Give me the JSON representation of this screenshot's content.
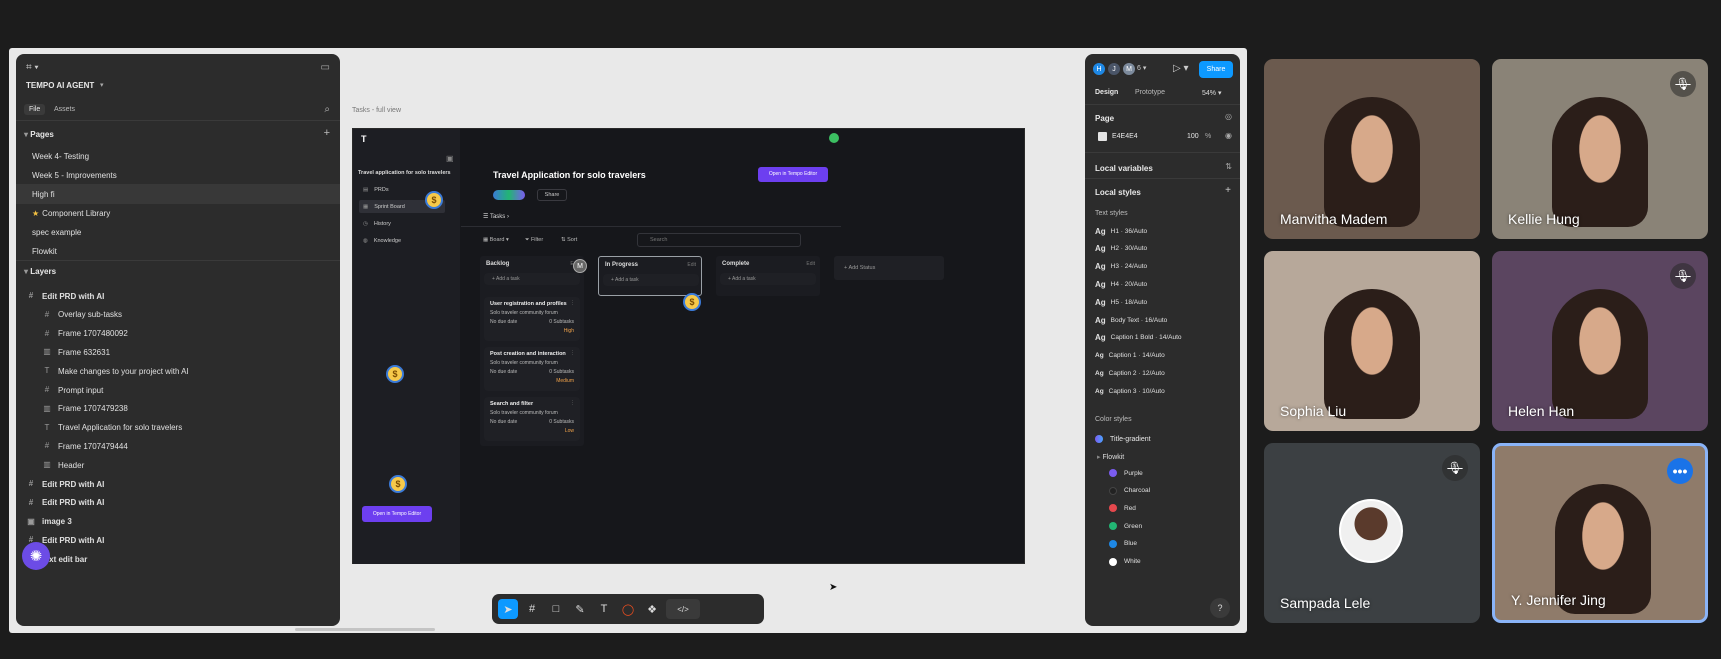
{
  "left_panel": {
    "project_name": "TEMPO AI AGENT",
    "tabs": [
      "File",
      "Assets"
    ],
    "pages_label": "Pages",
    "pages": [
      "Week 4- Testing",
      "Week 5 - Improvements",
      "High fi",
      "Component Library",
      "spec example",
      "Flowkit"
    ],
    "layers_label": "Layers",
    "layers": [
      {
        "label": "Edit PRD with AI",
        "indent": 0,
        "icon": "#"
      },
      {
        "label": "Overlay sub-tasks",
        "indent": 1,
        "icon": "#"
      },
      {
        "label": "Frame 1707480092",
        "indent": 1,
        "icon": "#"
      },
      {
        "label": "Frame 632631",
        "indent": 1,
        "icon": "▥"
      },
      {
        "label": "Make changes to your project with AI",
        "indent": 1,
        "icon": "T"
      },
      {
        "label": "Prompt input",
        "indent": 1,
        "icon": "#"
      },
      {
        "label": "Frame 1707479238",
        "indent": 1,
        "icon": "▥"
      },
      {
        "label": "Travel Application for solo travelers",
        "indent": 1,
        "icon": "T"
      },
      {
        "label": "Frame 1707479444",
        "indent": 1,
        "icon": "#"
      },
      {
        "label": "Header",
        "indent": 1,
        "icon": "▥"
      },
      {
        "label": "Edit PRD with AI",
        "indent": 0,
        "icon": "#"
      },
      {
        "label": "Edit PRD with AI",
        "indent": 0,
        "icon": "#"
      },
      {
        "label": "image 3",
        "indent": 0,
        "icon": "▣"
      },
      {
        "label": "Edit PRD with AI",
        "indent": 0,
        "icon": "#"
      },
      {
        "label": "text edit bar",
        "indent": 0,
        "icon": "#"
      }
    ]
  },
  "canvas": {
    "frame_label": "Tasks - full view",
    "app": {
      "logo": "T",
      "sidebar_title": "Travel application for solo travelers",
      "nav": [
        "PRDs",
        "Sprint Board",
        "History",
        "Knowledge"
      ],
      "open_btn": "Open in Tempo Editor",
      "title": "Travel Application for solo travelers",
      "share": "Share",
      "tasks_label": "Tasks",
      "toolbar": [
        "Board",
        "Filter",
        "Sort"
      ],
      "search_placeholder": "Search",
      "columns": [
        {
          "name": "Backlog",
          "add": "Add a task"
        },
        {
          "name": "In Progress",
          "add": "Add a task"
        },
        {
          "name": "Complete",
          "add": "Add a task"
        }
      ],
      "add_status": "Add Status",
      "cards": [
        {
          "title": "User registration and profiles",
          "tag": "Solo traveler community forum",
          "due": "No due date",
          "subtasks": "0 Subtasks",
          "priority": "High"
        },
        {
          "title": "Post creation and interaction",
          "tag": "Solo traveler community forum",
          "due": "No due date",
          "subtasks": "0 Subtasks",
          "priority": "Medium"
        },
        {
          "title": "Search and filter",
          "tag": "Solo traveler community forum",
          "due": "No due date",
          "subtasks": "0 Subtasks",
          "priority": "Low"
        }
      ],
      "avatar_m": "M",
      "coin": "$"
    }
  },
  "toolbar": {
    "code_label": "</>"
  },
  "right_panel": {
    "avatars": [
      "H",
      "J",
      "M"
    ],
    "avatar_count": "6",
    "share": "Share",
    "tabs": [
      "Design",
      "Prototype"
    ],
    "zoom": "54%",
    "page_label": "Page",
    "page_color": "E4E4E4",
    "page_opacity": "100",
    "percent": "%",
    "local_variables": "Local variables",
    "local_styles": "Local styles",
    "text_styles_label": "Text styles",
    "text_styles": [
      "H1 · 36/Auto",
      "H2 · 30/Auto",
      "H3 · 24/Auto",
      "H4 · 20/Auto",
      "H5 · 18/Auto",
      "Body Text · 16/Auto",
      "Caption 1 Bold · 14/Auto",
      "Caption 1 · 14/Auto",
      "Caption 2 · 12/Auto",
      "Caption 3 · 10/Auto"
    ],
    "color_styles_label": "Color styles",
    "title_gradient": "Title-gradient",
    "flowkit": "Flowkit",
    "colors": [
      {
        "name": "Purple",
        "hex": "#7b5cf0"
      },
      {
        "name": "Charcoal",
        "hex": "#222222"
      },
      {
        "name": "Red",
        "hex": "#e5484d"
      },
      {
        "name": "Green",
        "hex": "#22b573"
      },
      {
        "name": "Blue",
        "hex": "#1e88e5"
      },
      {
        "name": "White",
        "hex": "#ffffff"
      }
    ],
    "help": "?"
  },
  "participants": [
    {
      "name": "Manvitha Madem",
      "muted": false,
      "bg": "#6b5a4e"
    },
    {
      "name": "Kellie Hung",
      "muted": true,
      "bg": "#8a8377"
    },
    {
      "name": "Sophia Liu",
      "muted": false,
      "bg": "#b7a89a"
    },
    {
      "name": "Helen Han",
      "muted": true,
      "bg": "#5b4560"
    },
    {
      "name": "Sampada Lele",
      "muted": true,
      "bg": "#3c4043",
      "avatar": true
    },
    {
      "name": "Y. Jennifer Jing",
      "muted": false,
      "bg": "#8f7b6a",
      "active": true
    }
  ]
}
